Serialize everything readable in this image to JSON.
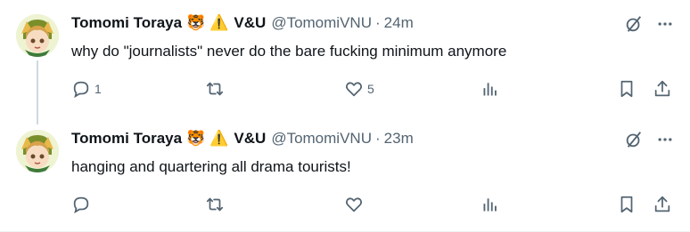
{
  "tweets": [
    {
      "name": "Tomomi Toraya",
      "emoji_tiger": "🐯",
      "emoji_warning": "⚠️",
      "tag": "V&U",
      "handle": "@TomomiVNU",
      "separator": "·",
      "time": "24m",
      "text": "why do \"journalists\" never do the bare fucking minimum anymore",
      "reply_count": "1",
      "retweet_count": "",
      "like_count": "5"
    },
    {
      "name": "Tomomi Toraya",
      "emoji_tiger": "🐯",
      "emoji_warning": "⚠️",
      "tag": "V&U",
      "handle": "@TomomiVNU",
      "separator": "·",
      "time": "23m",
      "text": "hanging and quartering all drama tourists!",
      "reply_count": "",
      "retweet_count": "",
      "like_count": ""
    }
  ],
  "icons": {
    "grok": "grok-slash-circle-icon",
    "more": "more-dots-icon",
    "reply": "reply-bubble-icon",
    "retweet": "retweet-arrows-icon",
    "like": "heart-icon",
    "views": "views-bars-icon",
    "bookmark": "bookmark-icon",
    "share": "share-upload-icon"
  },
  "colors": {
    "text": "#0f1419",
    "muted": "#536471",
    "thread_line": "#cfd9de"
  }
}
